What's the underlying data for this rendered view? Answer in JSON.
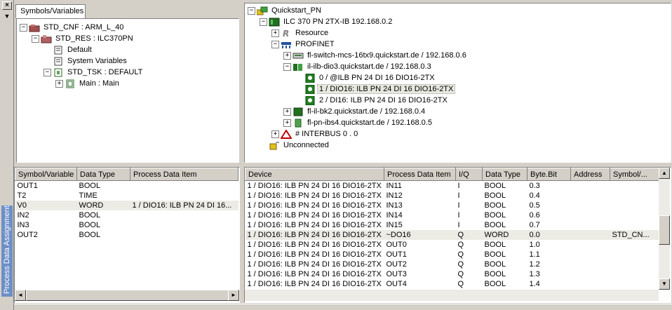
{
  "dock": {
    "title": "Process Data Assignment",
    "close_label": "×",
    "pin_label": "▼"
  },
  "left_top": {
    "tab_label": "Symbols/Variables",
    "tree": [
      {
        "label": "STD_CNF : ARM_L_40",
        "icon": "configuration-icon",
        "level": 0,
        "toggle": "−"
      },
      {
        "label": "STD_RES : ILC370PN",
        "icon": "resource-icon",
        "level": 1,
        "toggle": "−"
      },
      {
        "label": "Default",
        "icon": "variables-sheet-icon",
        "level": 2,
        "toggle": ""
      },
      {
        "label": "System Variables",
        "icon": "variables-sheet-icon",
        "level": 2,
        "toggle": ""
      },
      {
        "label": "STD_TSK : DEFAULT",
        "icon": "task-icon",
        "level": 2,
        "toggle": "−"
      },
      {
        "label": "Main : Main",
        "icon": "program-icon",
        "level": 3,
        "toggle": "+"
      }
    ]
  },
  "right_top": {
    "tree": [
      {
        "label": "Quickstart_PN",
        "icon": "project-icon",
        "level": 0,
        "toggle": "−"
      },
      {
        "label": "ILC 370 PN 2TX-IB 192.168.0.2",
        "icon": "controller-icon",
        "level": 1,
        "toggle": "−"
      },
      {
        "label": "Resource",
        "icon": "resource-r-icon",
        "level": 2,
        "toggle": "+"
      },
      {
        "label": "PROFINET",
        "icon": "profinet-icon",
        "level": 2,
        "toggle": "−"
      },
      {
        "label": "fl-switch-mcs-16tx9.quickstart.de / 192.168.0.6",
        "icon": "switch-icon",
        "level": 3,
        "toggle": "+"
      },
      {
        "label": "il-ilb-dio3.quickstart.de / 192.168.0.3",
        "icon": "io-module-icon",
        "level": 3,
        "toggle": "−"
      },
      {
        "label": "0 / @ILB PN 24 DI 16 DIO16-2TX",
        "icon": "io-channel-icon",
        "level": 4,
        "toggle": ""
      },
      {
        "label": "1 / DIO16: ILB PN 24 DI 16 DIO16-2TX",
        "icon": "io-channel-icon",
        "level": 4,
        "toggle": "",
        "selected": true
      },
      {
        "label": "2 / DI16: ILB PN 24 DI 16 DIO16-2TX",
        "icon": "io-channel-icon",
        "level": 4,
        "toggle": ""
      },
      {
        "label": "fl-il-bk2.quickstart.de / 192.168.0.4",
        "icon": "bus-coupler-icon",
        "level": 3,
        "toggle": "+"
      },
      {
        "label": "fl-pn-ibs4.quickstart.de / 192.168.0.5",
        "icon": "proxy-icon",
        "level": 3,
        "toggle": "+"
      },
      {
        "label": "# INTERBUS 0 . 0",
        "icon": "interbus-icon",
        "level": 2,
        "toggle": "+"
      },
      {
        "label": "Unconnected",
        "icon": "unconnected-icon",
        "level": 1,
        "toggle": ""
      }
    ]
  },
  "left_table": {
    "columns": [
      "Symbol/Variable",
      "Data Type",
      "Process Data Item"
    ],
    "rows": [
      [
        "OUT1",
        "BOOL",
        ""
      ],
      [
        "T2",
        "TIME",
        ""
      ],
      [
        "V0",
        "WORD",
        "1 / DIO16: ILB PN 24 DI 16..."
      ],
      [
        "IN2",
        "BOOL",
        ""
      ],
      [
        "IN3",
        "BOOL",
        ""
      ],
      [
        "OUT2",
        "BOOL",
        ""
      ]
    ],
    "highlight_row": 2
  },
  "right_table": {
    "columns": [
      "Device",
      "Process Data Item",
      "I/Q",
      "Data Type",
      "Byte.Bit",
      "Address",
      "Symbol/..."
    ],
    "rows": [
      [
        "1 / DIO16: ILB PN 24 DI 16 DIO16-2TX",
        "IN11",
        "I",
        "BOOL",
        "0.3",
        "",
        ""
      ],
      [
        "1 / DIO16: ILB PN 24 DI 16 DIO16-2TX",
        "IN12",
        "I",
        "BOOL",
        "0.4",
        "",
        ""
      ],
      [
        "1 / DIO16: ILB PN 24 DI 16 DIO16-2TX",
        "IN13",
        "I",
        "BOOL",
        "0.5",
        "",
        ""
      ],
      [
        "1 / DIO16: ILB PN 24 DI 16 DIO16-2TX",
        "IN14",
        "I",
        "BOOL",
        "0.6",
        "",
        ""
      ],
      [
        "1 / DIO16: ILB PN 24 DI 16 DIO16-2TX",
        "IN15",
        "I",
        "BOOL",
        "0.7",
        "",
        ""
      ],
      [
        "1 / DIO16: ILB PN 24 DI 16 DIO16-2TX",
        "~DO16",
        "Q",
        "WORD",
        "0.0",
        "",
        "STD_CN..."
      ],
      [
        "1 / DIO16: ILB PN 24 DI 16 DIO16-2TX",
        "OUT0",
        "Q",
        "BOOL",
        "1.0",
        "",
        ""
      ],
      [
        "1 / DIO16: ILB PN 24 DI 16 DIO16-2TX",
        "OUT1",
        "Q",
        "BOOL",
        "1.1",
        "",
        ""
      ],
      [
        "1 / DIO16: ILB PN 24 DI 16 DIO16-2TX",
        "OUT2",
        "Q",
        "BOOL",
        "1.2",
        "",
        ""
      ],
      [
        "1 / DIO16: ILB PN 24 DI 16 DIO16-2TX",
        "OUT3",
        "Q",
        "BOOL",
        "1.3",
        "",
        ""
      ],
      [
        "1 / DIO16: ILB PN 24 DI 16 DIO16-2TX",
        "OUT4",
        "Q",
        "BOOL",
        "1.4",
        "",
        ""
      ]
    ],
    "highlight_row": 5
  },
  "scroll": {
    "up": "▲",
    "down": "▼",
    "left": "◄",
    "right": "►"
  }
}
